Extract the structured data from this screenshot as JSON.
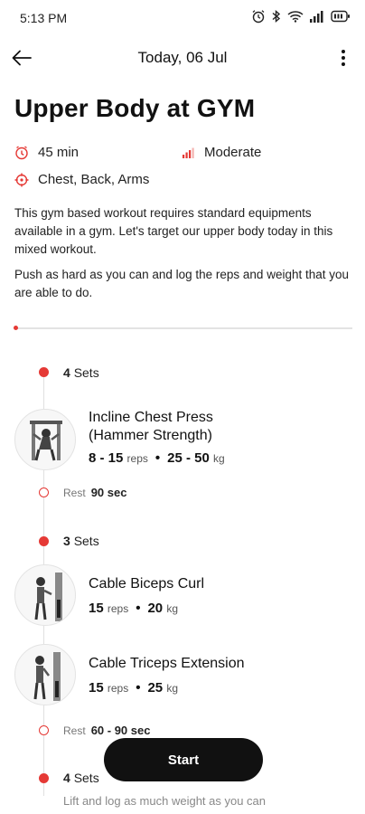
{
  "status_bar": {
    "time": "5:13 PM",
    "icons": [
      "alarm-icon",
      "bluetooth-icon",
      "wifi-icon",
      "signal-icon",
      "battery-icon"
    ]
  },
  "app_bar": {
    "title": "Today, 06 Jul",
    "back_icon": "arrow-left-icon",
    "more_icon": "more-vertical-icon"
  },
  "workout": {
    "title": "Upper Body at GYM",
    "duration": "45 min",
    "intensity": "Moderate",
    "muscles": "Chest, Back, Arms",
    "description_1": "This gym based workout requires standard equipments available in a gym. Let's target our upper body today in this mixed workout.",
    "description_2": "Push as hard as you can and log the reps and weight that you are able to do.",
    "progress": 0.0
  },
  "blocks": [
    {
      "sets_count": "4",
      "sets_word": "Sets",
      "exercises": [
        {
          "name_line1": "Incline Chest Press",
          "name_line2": "(Hammer Strength)",
          "reps": "8 - 15",
          "reps_unit": "reps",
          "weight": "25 - 50",
          "weight_unit": "kg"
        }
      ],
      "rest_label": "Rest",
      "rest_value": "90 sec"
    },
    {
      "sets_count": "3",
      "sets_word": "Sets",
      "exercises": [
        {
          "name_line1": "Cable Biceps Curl",
          "reps": "15",
          "reps_unit": "reps",
          "weight": "20",
          "weight_unit": "kg"
        },
        {
          "name_line1": "Cable Triceps Extension",
          "reps": "15",
          "reps_unit": "reps",
          "weight": "25",
          "weight_unit": "kg"
        }
      ],
      "rest_label": "Rest",
      "rest_value": "60 - 90 sec"
    },
    {
      "sets_count": "4",
      "sets_word": "Sets",
      "note": "Lift and log as much weight as you can"
    }
  ],
  "start_button": "Start",
  "colors": {
    "accent": "#e53935",
    "button": "#111111"
  }
}
